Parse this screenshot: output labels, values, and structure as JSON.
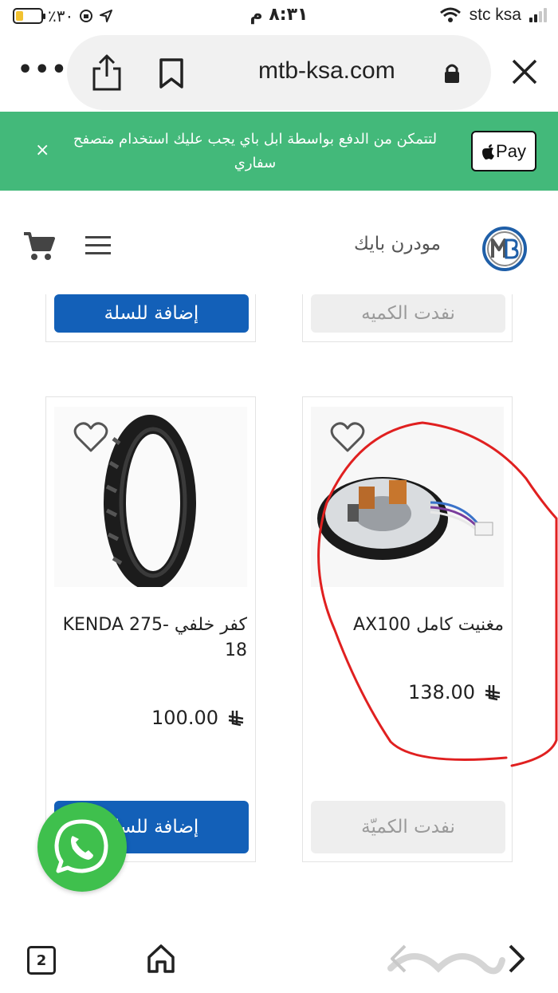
{
  "status_bar": {
    "battery_percent": "٪٣٠",
    "time": "٨:٣١ م",
    "carrier": "stc ksa"
  },
  "browser": {
    "url": "mtb-ksa.com",
    "tab_count": "2"
  },
  "banner": {
    "message": "لتتمكن من الدفع بواسطة ابل باي يجب عليك استخدام متصفح سفاري",
    "apple_pay_label": "Pay",
    "close_label": "×"
  },
  "site": {
    "brand_name": "مودرن بايك"
  },
  "top_row": {
    "right_button": "نفدت الكميه",
    "left_button": "إضافة للسلة"
  },
  "products": [
    {
      "title": "مغنيت كامل AX100",
      "price": "138.00",
      "button": "نفدت الكميّة",
      "status": "soldout"
    },
    {
      "title": "كفر خلفي KENDA 275-18",
      "price": "100.00",
      "button": "إضافة للسلة",
      "status": "available"
    }
  ],
  "colors": {
    "banner_green": "#43b97a",
    "add_button_blue": "#1360b8",
    "whatsapp_green": "#3fc04d",
    "annotation_red": "#e02020"
  }
}
